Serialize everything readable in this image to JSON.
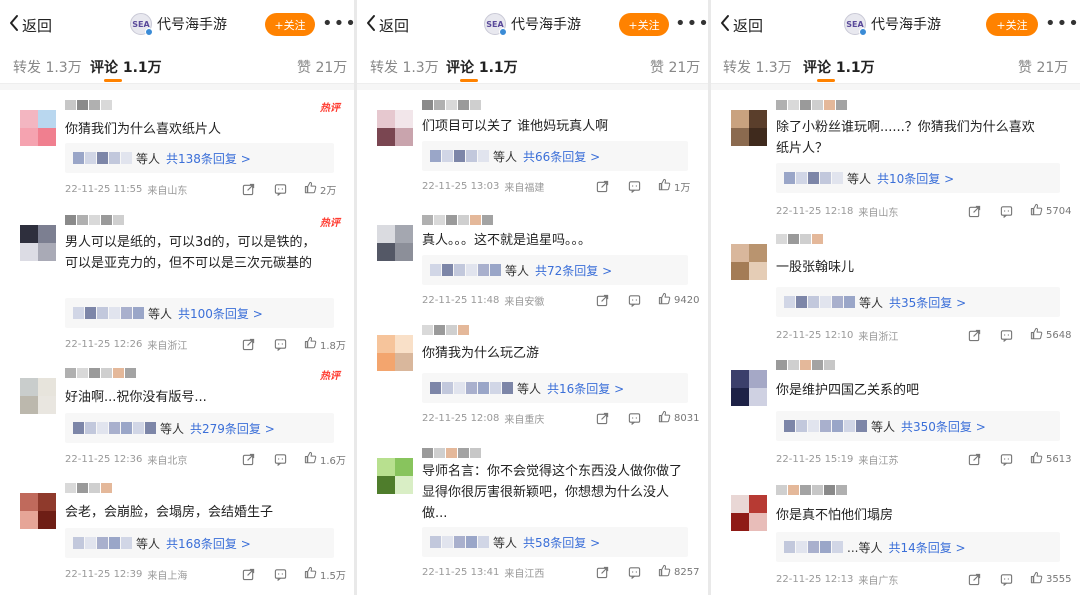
{
  "panels": [
    {
      "header": {
        "back": "返回",
        "account": "代号海手游",
        "logo": "SEA",
        "follow": "+关注",
        "more": "•••"
      },
      "tabs": {
        "forward": "转发 1.3万",
        "comment": "评论 1.1万",
        "likes": "赞 21万"
      },
      "comments": [
        {
          "hot": "热评",
          "text": [
            "你猜我们为什么喜欢纸片人"
          ],
          "reply_prefix": "等人",
          "reply_count": "共138条回复 >",
          "date": "22-11-25 11:55",
          "location": "来自山东",
          "likes": "2万"
        },
        {
          "hot": "热评",
          "text": [
            "男人可以是纸的，可以3d的，可以是铁的，",
            "可以是亚克力的，但不可以是三次元碳基的"
          ],
          "reply_prefix": "等人",
          "reply_count": "共100条回复 >",
          "date": "22-11-25 12:26",
          "location": "来自浙江",
          "likes": "1.8万"
        },
        {
          "hot": "热评",
          "text": [
            "好油啊...祝你没有版号..."
          ],
          "reply_prefix": "等人",
          "reply_count": "共279条回复 >",
          "date": "22-11-25 12:36",
          "location": "来自北京",
          "likes": "1.6万"
        },
        {
          "hot": "",
          "text": [
            "会老，会崩脸，会塌房，会结婚生子"
          ],
          "reply_prefix": "等人",
          "reply_count": "共168条回复 >",
          "date": "22-11-25 12:39",
          "location": "来自上海",
          "likes": "1.5万"
        }
      ]
    },
    {
      "header": {
        "back": "返回",
        "account": "代号海手游",
        "logo": "SEA",
        "follow": "+关注",
        "more": "•••"
      },
      "tabs": {
        "forward": "转发 1.3万",
        "comment": "评论 1.1万",
        "likes": "赞 21万"
      },
      "comments": [
        {
          "hot": "",
          "text": [
            "们项目可以关了 谁他妈玩真人啊"
          ],
          "reply_prefix": "等人",
          "reply_count": "共66条回复 >",
          "date": "22-11-25 13:03",
          "location": "来自福建",
          "likes": "1万"
        },
        {
          "hot": "",
          "text": [
            "真人。。。这不就是追星吗。。。"
          ],
          "reply_prefix": "等人",
          "reply_count": "共72条回复 >",
          "date": "22-11-25 11:48",
          "location": "来自安徽",
          "likes": "9420"
        },
        {
          "hot": "",
          "text": [
            "你猜我为什么玩乙游"
          ],
          "reply_prefix": "等人",
          "reply_count": "共16条回复 >",
          "date": "22-11-25 12:08",
          "location": "来自重庆",
          "likes": "8031"
        },
        {
          "hot": "",
          "text": [
            "导师名言：你不会觉得这个东西没人做你做了",
            "显得你很厉害很新颖吧，你想想为什么没人",
            "做..."
          ],
          "reply_prefix": "等人",
          "reply_count": "共58条回复 >",
          "date": "22-11-25 13:41",
          "location": "来自江西",
          "likes": "8257"
        }
      ]
    },
    {
      "header": {
        "back": "返回",
        "account": "代号海手游",
        "logo": "SEA",
        "follow": "+关注",
        "more": "•••"
      },
      "tabs": {
        "forward": "转发 1.3万",
        "comment": "评论 1.1万",
        "likes": "赞 21万"
      },
      "comments": [
        {
          "hot": "",
          "text": [
            "除了小粉丝谁玩啊......？你猜我们为什么喜欢",
            "纸片人？"
          ],
          "reply_prefix": "等人",
          "reply_count": "共10条回复 >",
          "date": "22-11-25 12:18",
          "location": "来自山东",
          "likes": "5704"
        },
        {
          "hot": "",
          "text": [
            "一股张翰味儿"
          ],
          "reply_prefix": "等人",
          "reply_count": "共35条回复 >",
          "date": "22-11-25 12:10",
          "location": "来自浙江",
          "likes": "5648"
        },
        {
          "hot": "",
          "text": [
            "你是维护四国乙关系的吧"
          ],
          "reply_prefix": "等人",
          "reply_count": "共350条回复 >",
          "date": "22-11-25 15:19",
          "location": "来自江苏",
          "likes": "5613"
        },
        {
          "hot": "",
          "text": [
            "你是真不怕他们塌房"
          ],
          "reply_prefix": "...等人",
          "reply_count": "共14条回复 >",
          "date": "22-11-25 12:13",
          "location": "来自广东",
          "likes": "3555"
        }
      ]
    }
  ],
  "colors": {
    "accent": "#ff8200",
    "link": "#3b6fd8",
    "hot": "#ff3b30"
  }
}
